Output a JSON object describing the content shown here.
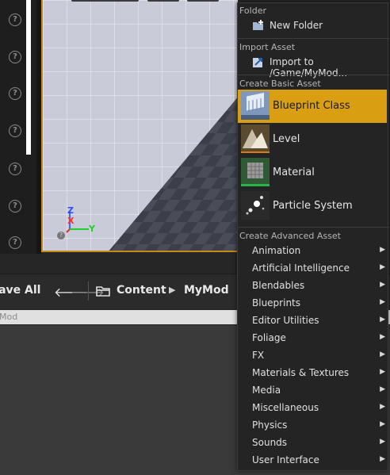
{
  "toolbar": {
    "save_all": "Save All",
    "back_arrow": "🡐",
    "forward_arrow": "🡒",
    "breadcrumb": [
      "Content",
      "MyMod"
    ]
  },
  "search": {
    "text": "Mod"
  },
  "left_panel": {
    "help_glyph": "?"
  },
  "gizmo": {
    "z": "Z",
    "x": "X",
    "y": "Y"
  },
  "menu": {
    "folder_header": "Folder",
    "new_folder": "New Folder",
    "import_header": "Import Asset",
    "import_label": "Import to /Game/MyMod...",
    "basic_header": "Create Basic Asset",
    "basic_items": [
      "Blueprint Class",
      "Level",
      "Material",
      "Particle System"
    ],
    "advanced_header": "Create Advanced Asset",
    "advanced_items": [
      "Animation",
      "Artificial Intelligence",
      "Blendables",
      "Blueprints",
      "Editor Utilities",
      "Foliage",
      "FX",
      "Materials & Textures",
      "Media",
      "Miscellaneous",
      "Physics",
      "Sounds",
      "User Interface"
    ],
    "submenu_arrow": "▶"
  },
  "colors": {
    "accent": "#d99e12",
    "menu_bg": "#242424",
    "viewport_border": "#c58a17"
  }
}
